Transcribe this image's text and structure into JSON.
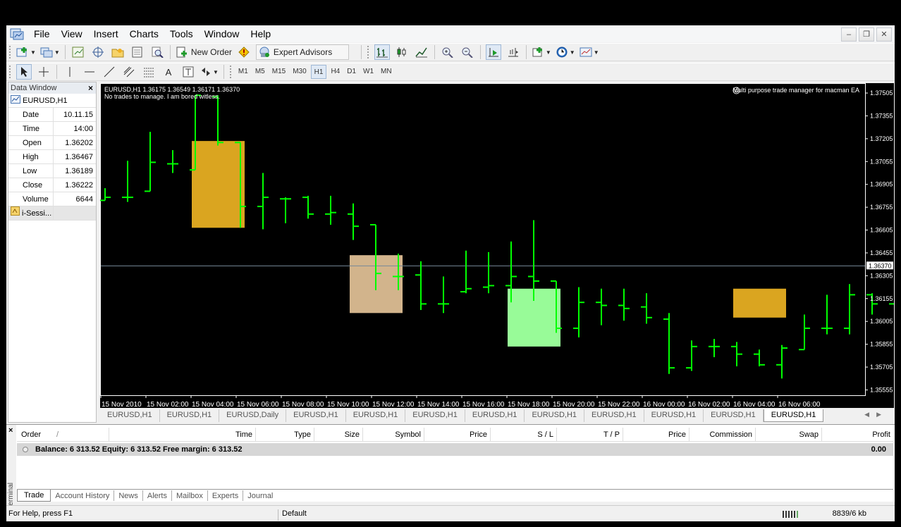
{
  "menu": [
    "File",
    "View",
    "Insert",
    "Charts",
    "Tools",
    "Window",
    "Help"
  ],
  "window_buttons": [
    "–",
    "❐",
    "✕"
  ],
  "toolbar": {
    "new_order": "New Order",
    "expert_advisors": "Expert Advisors",
    "timeframes": [
      "M1",
      "M5",
      "M15",
      "M30",
      "H1",
      "H4",
      "D1",
      "W1",
      "MN"
    ],
    "active_timeframe": "H1",
    "text_tool": "A"
  },
  "data_window": {
    "title": "Data Window",
    "symbol": "EURUSD,H1",
    "rows": [
      {
        "k": "Date",
        "v": "10.11.15"
      },
      {
        "k": "Time",
        "v": "14:00"
      },
      {
        "k": "Open",
        "v": "1.36202"
      },
      {
        "k": "High",
        "v": "1.36467"
      },
      {
        "k": "Low",
        "v": "1.36189"
      },
      {
        "k": "Close",
        "v": "1.36222"
      },
      {
        "k": "Volume",
        "v": "6644"
      }
    ],
    "indicator": "i-Sessi..."
  },
  "chart": {
    "info_line1": "EURUSD,H1  1.36175 1.36549 1.36171 1.36370",
    "info_line2": "No trades to manage. I am bored witless.",
    "ea_label": "Multi purpose trade manager for macman EA",
    "current_price": "1.36370",
    "colors": {
      "background": "#000000",
      "bars": "#00ff00",
      "session_asia": "#daa520",
      "session_europe": "#d2b48c",
      "session_us": "#98fb98",
      "price_line": "#778899"
    }
  },
  "chart_data": {
    "type": "ohlc",
    "y_ticks": [
      "1.37505",
      "1.37355",
      "1.37205",
      "1.37055",
      "1.36905",
      "1.36755",
      "1.36605",
      "1.36455",
      "1.36305",
      "1.36155",
      "1.36005",
      "1.35855",
      "1.35705",
      "1.35555"
    ],
    "x_ticks": [
      "15 Nov 2010",
      "15 Nov 02:00",
      "15 Nov 04:00",
      "15 Nov 06:00",
      "15 Nov 08:00",
      "15 Nov 10:00",
      "15 Nov 12:00",
      "15 Nov 14:00",
      "15 Nov 16:00",
      "15 Nov 18:00",
      "15 Nov 20:00",
      "15 Nov 22:00",
      "16 Nov 00:00",
      "16 Nov 02:00",
      "16 Nov 04:00",
      "16 Nov 06:00"
    ],
    "ylim": [
      1.3552,
      1.3757
    ],
    "bars": [
      [
        1.368,
        1.3688,
        1.368,
        1.3682
      ],
      [
        1.3682,
        1.3706,
        1.3679,
        1.3682
      ],
      [
        1.3686,
        1.3725,
        1.3686,
        1.3705
      ],
      [
        1.3704,
        1.3713,
        1.3698,
        1.3704
      ],
      [
        1.37,
        1.3749,
        1.37,
        1.3749
      ],
      [
        1.3748,
        1.3749,
        1.3716,
        1.3718
      ],
      [
        1.3718,
        1.3718,
        1.3662,
        1.3676
      ],
      [
        1.3676,
        1.3698,
        1.3661,
        1.3682
      ],
      [
        1.3681,
        1.3682,
        1.3665,
        1.3681
      ],
      [
        1.3682,
        1.3683,
        1.3668,
        1.3671
      ],
      [
        1.3671,
        1.3683,
        1.3664,
        1.3672
      ],
      [
        1.3671,
        1.3678,
        1.3654,
        1.3663
      ],
      [
        1.3664,
        1.3664,
        1.3621,
        1.3632
      ],
      [
        1.363,
        1.3645,
        1.3621,
        1.363
      ],
      [
        1.3631,
        1.364,
        1.3608,
        1.3612
      ],
      [
        1.3612,
        1.363,
        1.3606,
        1.3612
      ],
      [
        1.362,
        1.3647,
        1.3619,
        1.3622
      ],
      [
        1.3623,
        1.3646,
        1.3619,
        1.3624
      ],
      [
        1.3624,
        1.3653,
        1.3613,
        1.363
      ],
      [
        1.363,
        1.3667,
        1.3614,
        1.3627
      ],
      [
        1.3627,
        1.3627,
        1.3593,
        1.3596
      ],
      [
        1.3596,
        1.3623,
        1.359,
        1.3613
      ],
      [
        1.3613,
        1.3622,
        1.3598,
        1.3611
      ],
      [
        1.3611,
        1.3622,
        1.3601,
        1.3609
      ],
      [
        1.361,
        1.3619,
        1.3599,
        1.3603
      ],
      [
        1.3602,
        1.3606,
        1.3566,
        1.357
      ],
      [
        1.357,
        1.3588,
        1.3568,
        1.3584
      ],
      [
        1.3584,
        1.3589,
        1.3577,
        1.3584
      ],
      [
        1.3584,
        1.3587,
        1.3571,
        1.3579
      ],
      [
        1.3579,
        1.3582,
        1.3571,
        1.3572
      ],
      [
        1.3572,
        1.3585,
        1.3563,
        1.3583
      ],
      [
        1.3582,
        1.3605,
        1.3582,
        1.3596
      ],
      [
        1.3596,
        1.3618,
        1.3592,
        1.3596
      ],
      [
        1.3596,
        1.3625,
        1.3592,
        1.3618
      ],
      [
        1.3618,
        1.3619,
        1.3605,
        1.3612
      ],
      [
        1.3612,
        1.362,
        1.3608,
        1.3614
      ],
      [
        1.3613,
        1.3624,
        1.3612,
        1.3619
      ],
      [
        1.3618,
        1.3649,
        1.3617,
        1.3637
      ]
    ],
    "sessions": [
      {
        "from": 4,
        "to": 5,
        "high": 1.3719,
        "low": 1.3662,
        "color": "#daa520"
      },
      {
        "from": 11,
        "to": 12,
        "high": 1.3644,
        "low": 1.3606,
        "color": "#d2b48c"
      },
      {
        "from": 18,
        "to": 19,
        "high": 1.3622,
        "low": 1.3584,
        "color": "#98fb98"
      },
      {
        "from": 28,
        "to": 29,
        "high": 1.3622,
        "low": 1.3603,
        "color": "#daa520"
      }
    ],
    "price_line": 1.3637
  },
  "chart_tabs": [
    "EURUSD,H1",
    "EURUSD,H1",
    "EURUSD,Daily",
    "EURUSD,H1",
    "EURUSD,H1",
    "EURUSD,H1",
    "EURUSD,H1",
    "EURUSD,H1",
    "EURUSD,H1",
    "EURUSD,H1",
    "EURUSD,H1",
    "EURUSD,H1"
  ],
  "terminal": {
    "side_label": "Terminal",
    "columns": [
      "Order",
      "/",
      "Time",
      "Type",
      "Size",
      "Symbol",
      "Price",
      "S / L",
      "T / P",
      "Price",
      "Commission",
      "Swap",
      "Profit"
    ],
    "balance_row": "Balance: 6 313.52  Equity: 6 313.52  Free margin: 6 313.52",
    "profit": "0.00",
    "tabs": [
      "Trade",
      "Account History",
      "News",
      "Alerts",
      "Mailbox",
      "Experts",
      "Journal"
    ],
    "active_tab": "Trade"
  },
  "status": {
    "help": "For Help, press F1",
    "profile": "Default",
    "traffic": "8839/6 kb"
  }
}
